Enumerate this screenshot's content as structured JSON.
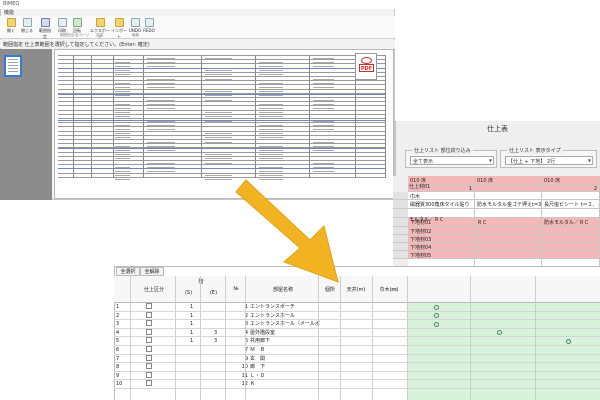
{
  "app": {
    "title": "BIMEQ",
    "menu": "機能",
    "ribbon_buttons": [
      "開く",
      "閉じる",
      "範囲指定",
      "印刷",
      "回転",
      "エクスポート",
      "インポート",
      "UNDO",
      "REDO"
    ],
    "ribbon_group_labels": [
      "範囲指定/全ページ",
      "変換",
      "編集"
    ],
    "info": "範囲指定 仕上表範囲を選択して指定してください。(Enter: 確定)"
  },
  "pdf_icon": {
    "label": "PDF"
  },
  "finish_panel": {
    "title": "仕上表",
    "filter_group": {
      "legend": "仕上リスト 部位絞り込み",
      "value": "全て表示"
    },
    "display_group": {
      "legend": "仕上リスト 表示タイプ",
      "value": "【仕上 + 下地】 2行"
    },
    "col_headers": [
      "010 床",
      "010 床",
      "010 床"
    ],
    "col_numbers": [
      "1",
      "",
      "2"
    ],
    "rows": [
      [
        "巾木",
        "",
        ""
      ],
      [
        "磁器質300角床タイル貼り",
        "防水モルタル金ゴテ押えt=30",
        "長尺塩ビシート t＝２、３"
      ],
      [
        "",
        "",
        ""
      ],
      [
        "下地材01",
        "ＲＣ",
        "防水モルタル／ＲＣ"
      ],
      [
        "下地材02",
        "",
        ""
      ],
      [
        "下地材03",
        "",
        ""
      ],
      [
        "下地材04",
        "",
        ""
      ],
      [
        "下地材05",
        "",
        ""
      ]
    ],
    "row_labels": [
      "仕上材01",
      "",
      "",
      "モルタル／ＲＣ",
      "",
      "",
      "",
      ""
    ]
  },
  "grid": {
    "select_all": "全選択",
    "deselect_all": "全解除",
    "headers": {
      "finish_category": "仕上区分",
      "floor": "階",
      "floor_s": "(S)",
      "floor_e": "(E)",
      "no": "№",
      "room_name": "部屋名称",
      "location": "個所",
      "ceiling_height": "天井(m)",
      "sill_height": "巾木(㎜)"
    },
    "rows": [
      {
        "row": "1",
        "s": "1",
        "e": "",
        "no": "1",
        "room": "エントランスポーチ",
        "marks": [
          1
        ]
      },
      {
        "row": "2",
        "s": "1",
        "e": "",
        "no": "2",
        "room": "エントランスホール",
        "marks": [
          1
        ]
      },
      {
        "row": "3",
        "s": "1",
        "e": "",
        "no": "3",
        "room": "エントランスホール（メールボックス）",
        "marks": [
          1
        ]
      },
      {
        "row": "4",
        "s": "1",
        "e": "3",
        "no": "4",
        "room": "屋外階段室",
        "marks": [
          2
        ]
      },
      {
        "row": "5",
        "s": "1",
        "e": "3",
        "no": "6",
        "room": "共用廊下",
        "marks": [
          3
        ]
      },
      {
        "row": "6",
        "s": "",
        "e": "",
        "no": "7",
        "room": "Ｍ　Ｂ",
        "marks": []
      },
      {
        "row": "7",
        "s": "",
        "e": "",
        "no": "9",
        "room": "玄　関",
        "marks": []
      },
      {
        "row": "8",
        "s": "",
        "e": "",
        "no": "10",
        "room": "廊　下",
        "marks": []
      },
      {
        "row": "9",
        "s": "",
        "e": "",
        "no": "11",
        "room": "Ｌ・Ｄ",
        "marks": []
      },
      {
        "row": "10",
        "s": "",
        "e": "",
        "no": "12",
        "room": "Ｋ",
        "marks": []
      }
    ],
    "mark_symbol": "○"
  },
  "colors": {
    "arrow": "#f2b322",
    "pink_row": "#f5b8b8",
    "green_cells": "#d8f2dc",
    "pdf_red": "#d32b2b",
    "selection_blue": "#3a7ad6"
  }
}
